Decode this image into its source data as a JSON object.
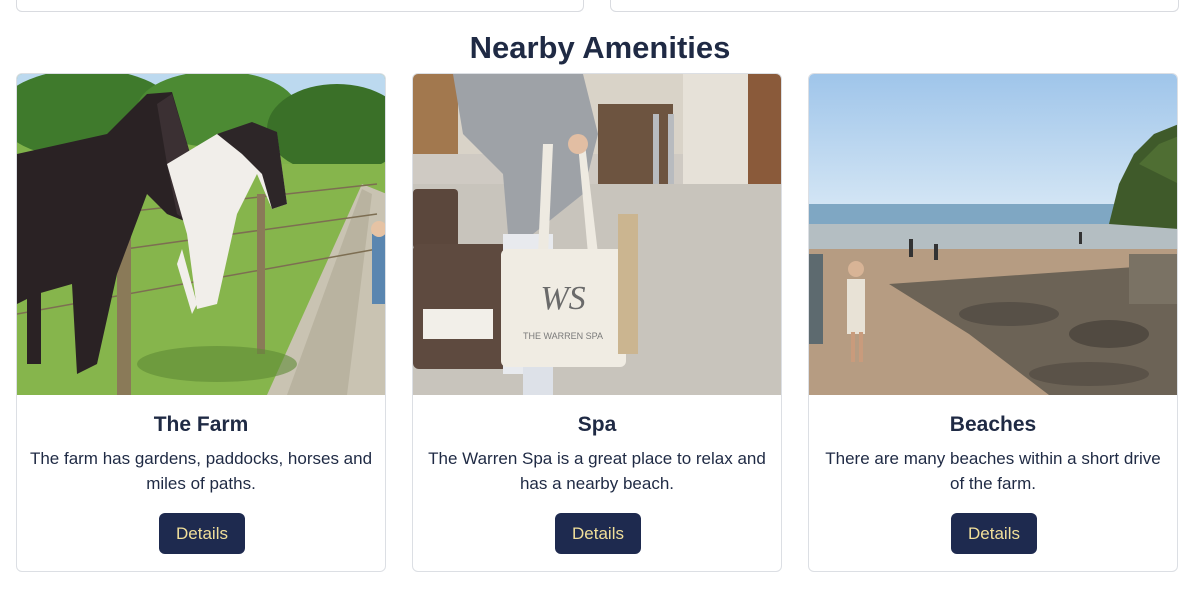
{
  "section": {
    "title": "Nearby Amenities"
  },
  "cards": [
    {
      "title": "The Farm",
      "text": "The farm has gardens, paddocks, horses and miles of paths.",
      "button": "Details",
      "image": "horses-by-fence-photo"
    },
    {
      "title": "Spa",
      "text": "The Warren Spa is a great place to relax and has a nearby beach.",
      "button": "Details",
      "image": "spa-tote-bag-photo",
      "bag_logo": "WS",
      "bag_text": "THE WARREN SPA"
    },
    {
      "title": "Beaches",
      "text": "There are many beaches within a short drive of the farm.",
      "button": "Details",
      "image": "beach-rockpools-photo"
    }
  ],
  "colors": {
    "button_bg": "#1e2a4f",
    "button_text": "#f1df9a",
    "heading": "#1f2a44",
    "card_border": "#dcdfe4"
  }
}
